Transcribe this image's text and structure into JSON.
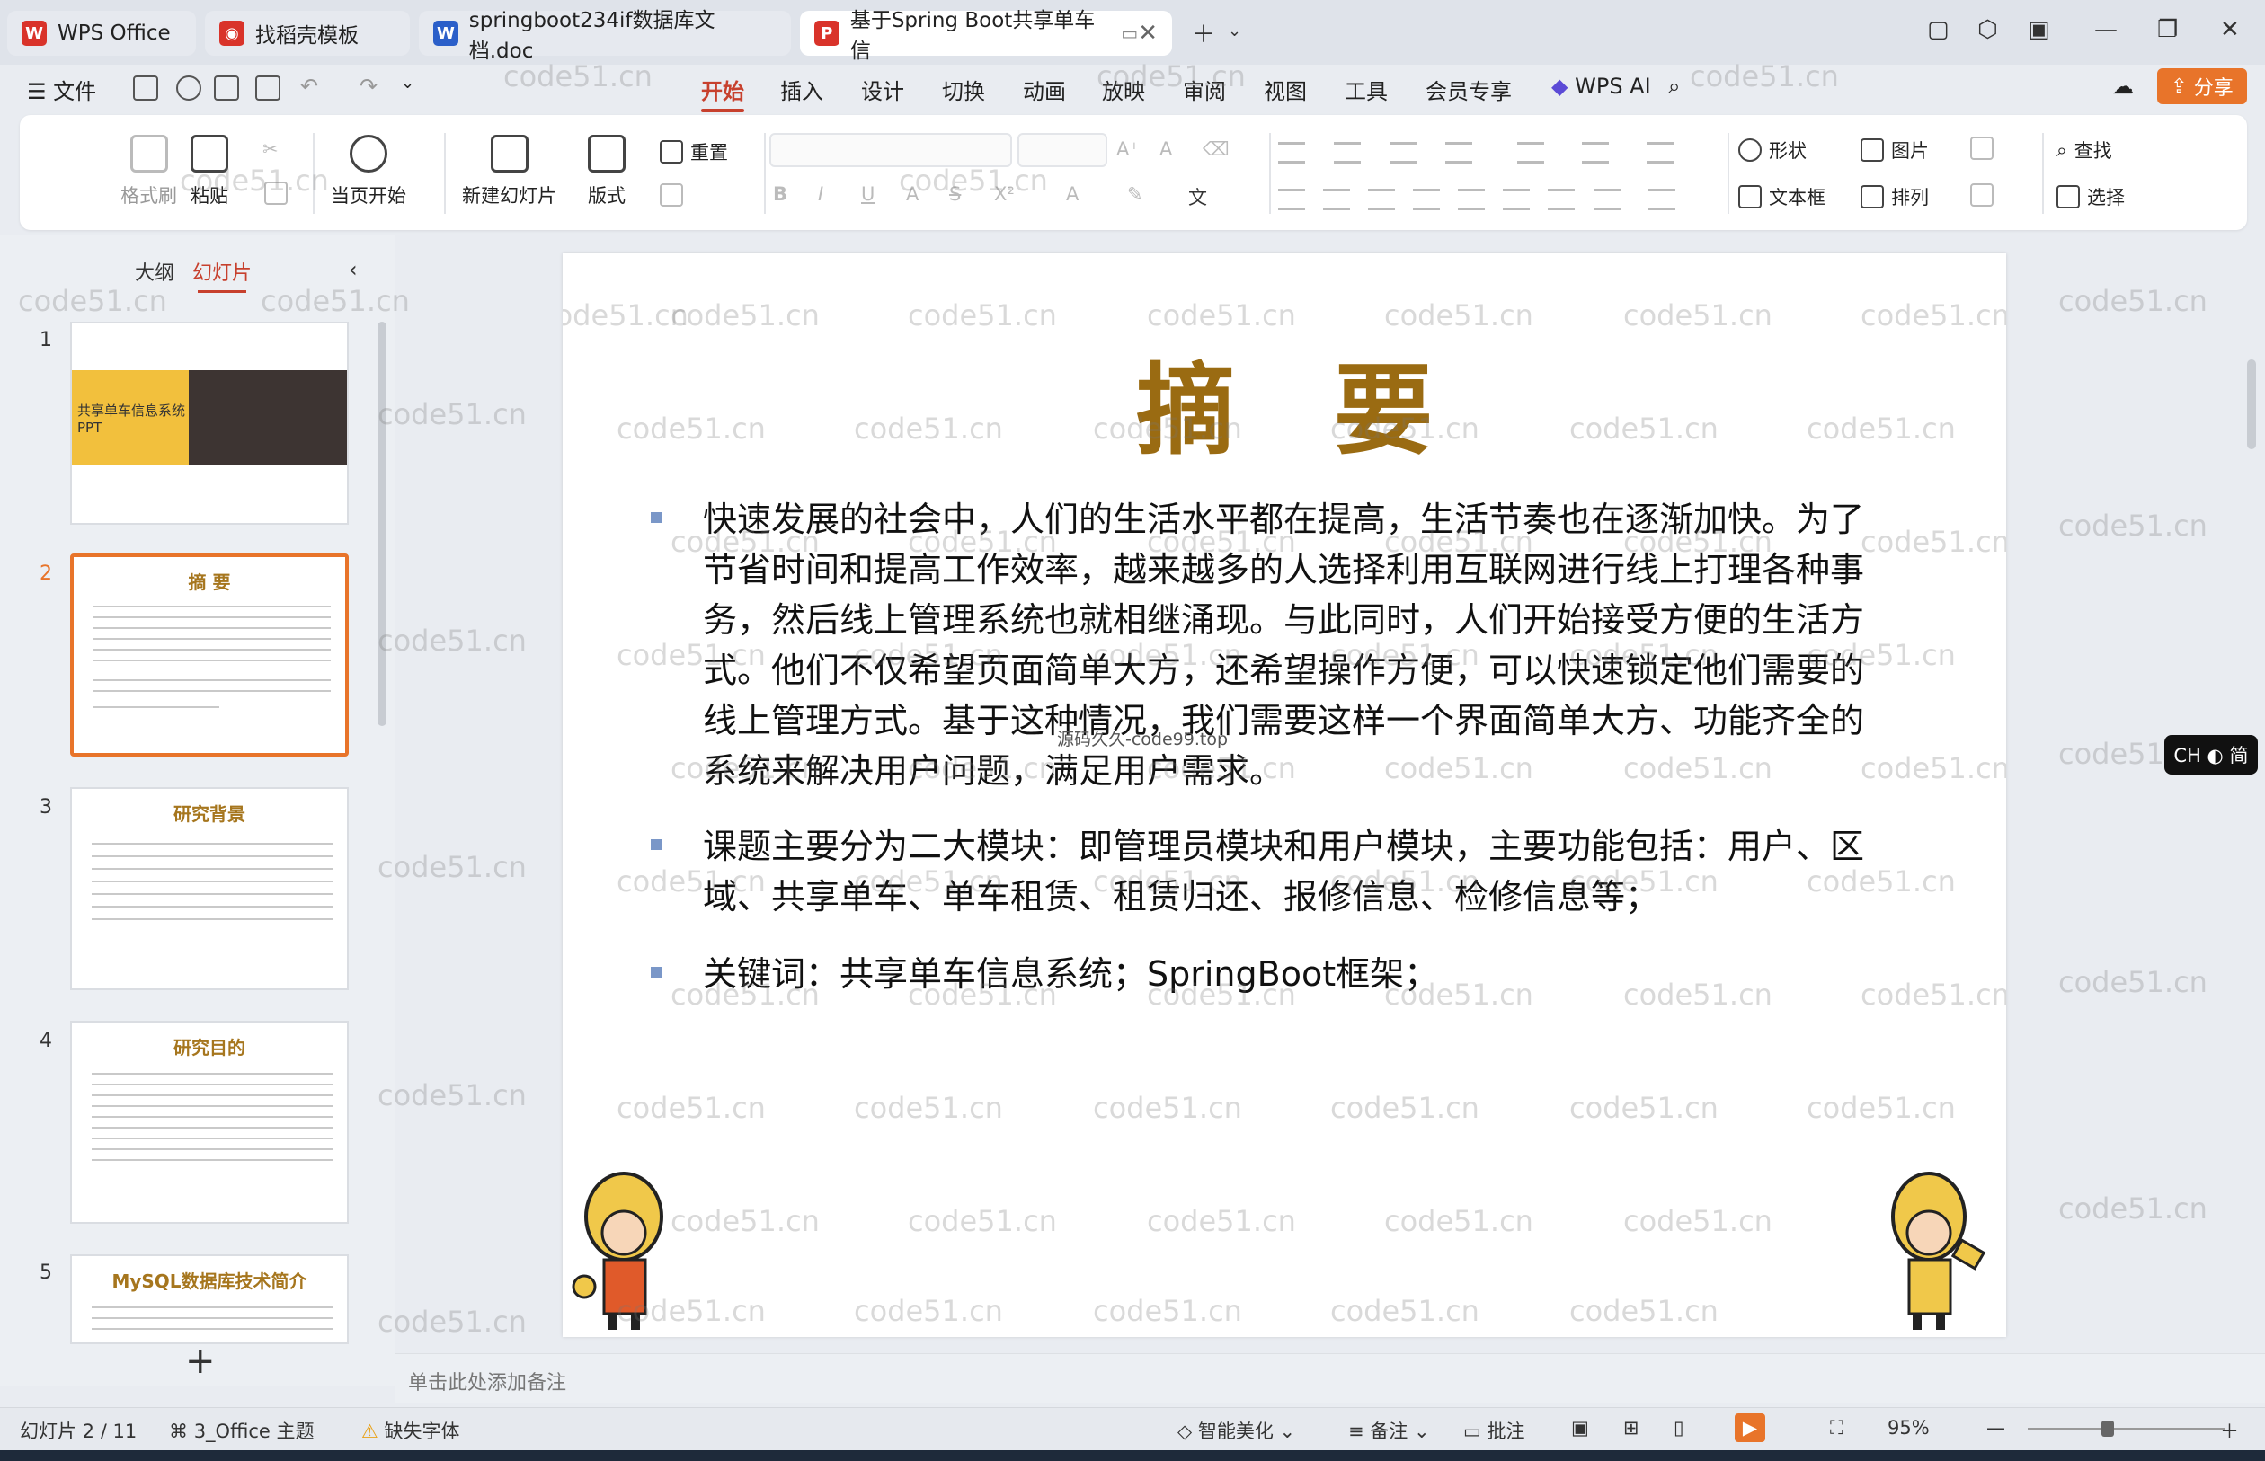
{
  "tabs": [
    {
      "label": "WPS Office",
      "icon": "wps-logo-icon",
      "color": "#d9332a"
    },
    {
      "label": "找稻壳模板",
      "icon": "docer-icon",
      "color": "#d9332a"
    },
    {
      "label": "springboot234if数据库文档.doc",
      "icon": "word-doc-icon",
      "color": "#2b5fc9"
    },
    {
      "label": "基于Spring Boot共享单车信",
      "icon": "ppt-icon",
      "color": "#d9332a"
    }
  ],
  "menubar": {
    "file_label": "文件",
    "items": [
      "开始",
      "插入",
      "设计",
      "切换",
      "动画",
      "放映",
      "审阅",
      "视图",
      "工具",
      "会员专享"
    ],
    "wps_ai": "WPS AI",
    "share": "分享"
  },
  "ribbon": {
    "format_painter": "格式刷",
    "paste": "粘贴",
    "start_from_current": "当页开始",
    "new_slide": "新建幻灯片",
    "layout": "版式",
    "reset": "重置",
    "shape": "形状",
    "picture": "图片",
    "find": "查找",
    "textbox": "文本框",
    "arrange": "排列",
    "select": "选择"
  },
  "left_panel": {
    "tab_outline": "大纲",
    "tab_slides": "幻灯片",
    "slides": [
      {
        "num": "1",
        "title": "共享单车信息系统PPT"
      },
      {
        "num": "2",
        "title": "摘 要"
      },
      {
        "num": "3",
        "title": "研究背景"
      },
      {
        "num": "4",
        "title": "研究目的"
      },
      {
        "num": "5",
        "title": "MySQL数据库技术简介"
      }
    ],
    "add_label": "+"
  },
  "slide": {
    "title": "摘要",
    "paragraphs": [
      "  快速发展的社会中，人们的生活水平都在提高，生活节奏也在逐渐加快。为了节省时间和提高工作效率，越来越多的人选择利用互联网进行线上打理各种事务，然后线上管理系统也就相继涌现。与此同时，人们开始接受方便的生活方式。他们不仅希望页面简单大方，还希望操作方便，可以快速锁定他们需要的线上管理方式。基于这种情况，我们需要这样一个界面简单大方、功能齐全的系统来解决用户问题，满足用户需求。",
      "课题主要分为二大模块：即管理员模块和用户模块，主要功能包括：用户、区域、共享单车、单车租赁、租赁归还、报修信息、检修信息等；",
      "关键词：共享单车信息系统；SpringBoot框架；"
    ],
    "center_watermark": "源码久久-code99.top",
    "watermark": "code51.cn"
  },
  "notes_placeholder": "单击此处添加备注",
  "statusbar": {
    "slide_count": "幻灯片 2 / 11",
    "theme": "3_Office 主题",
    "missing_font": "缺失字体",
    "beautify": "智能美化",
    "notes": "备注",
    "comments": "批注",
    "zoom": "95%"
  },
  "ime_badge": "CH ◐ 简",
  "colors": {
    "accent": "#c7402d",
    "share_bg": "#e8742a",
    "slide_title": "#9a6b12",
    "bullet": "#7a97c8"
  }
}
